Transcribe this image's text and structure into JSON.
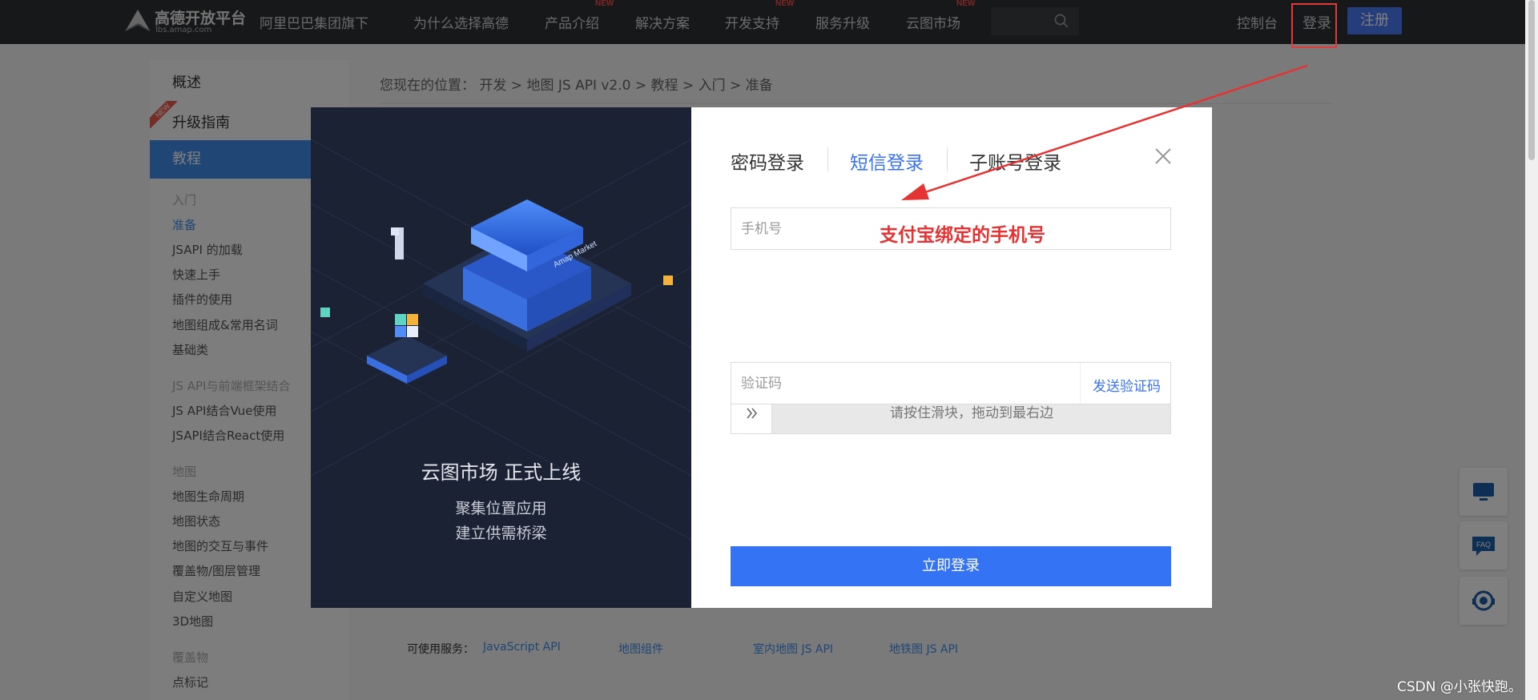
{
  "nav": {
    "logo_title": "高德开放平台",
    "logo_sub": "lbs.amap.com",
    "group": "阿里巴巴集团旗下",
    "items": [
      "为什么选择高德",
      "产品介绍",
      "解决方案",
      "开发支持",
      "服务升级",
      "云图市场"
    ],
    "new_tag": "NEW",
    "console": "控制台",
    "login": "登录",
    "register": "注册"
  },
  "sidebar": {
    "overview": "概述",
    "upgrade": "升级指南",
    "new_ribbon": "NEW",
    "tutorial": "教程",
    "group_intro": "入门",
    "intro_items": [
      "准备",
      "JSAPI 的加载",
      "快速上手",
      "插件的使用",
      "地图组成&常用名词",
      "基础类"
    ],
    "group_frameworks": "JS API与前端框架结合",
    "framework_items": [
      "JS API结合Vue使用",
      "JSAPI结合React使用"
    ],
    "group_map": "地图",
    "map_items": [
      "地图生命周期",
      "地图状态",
      "地图的交互与事件",
      "覆盖物/图层管理",
      "自定义地图",
      "3D地图"
    ],
    "group_overlay": "覆盖物",
    "overlay_items": [
      "点标记"
    ]
  },
  "breadcrumb": "您现在的位置：  开发 > 地图 JS API v2.0 > 教程 > 入门 > 准备",
  "services": {
    "label": "可使用服务：",
    "links": [
      "JavaScript API",
      "地图组件",
      "室内地图 JS API",
      "地铁图 JS API"
    ]
  },
  "modal": {
    "promo_title": "云图市场  正式上线",
    "promo_line1": "聚集位置应用",
    "promo_line2": "建立供需桥梁",
    "tabs": [
      "密码登录",
      "短信登录",
      "子账号登录"
    ],
    "phone_placeholder": "手机号",
    "annotation": "支付宝绑定的手机号",
    "slider_hint": "请按住滑块，拖动到最右边",
    "code_placeholder": "验证码",
    "send_code": "发送验证码",
    "submit": "立即登录",
    "market_label": "Amap Market"
  },
  "float_buttons": [
    "monitor-icon",
    "faq-icon",
    "support-icon"
  ],
  "watermark": "CSDN @小张快跑。",
  "colors": {
    "nav_bg": "#2f3034",
    "accent": "#3473f4",
    "sidebar_active": "#3e8de8",
    "annotation_red": "#e53333",
    "modal_left_bg": "#1b2233"
  }
}
